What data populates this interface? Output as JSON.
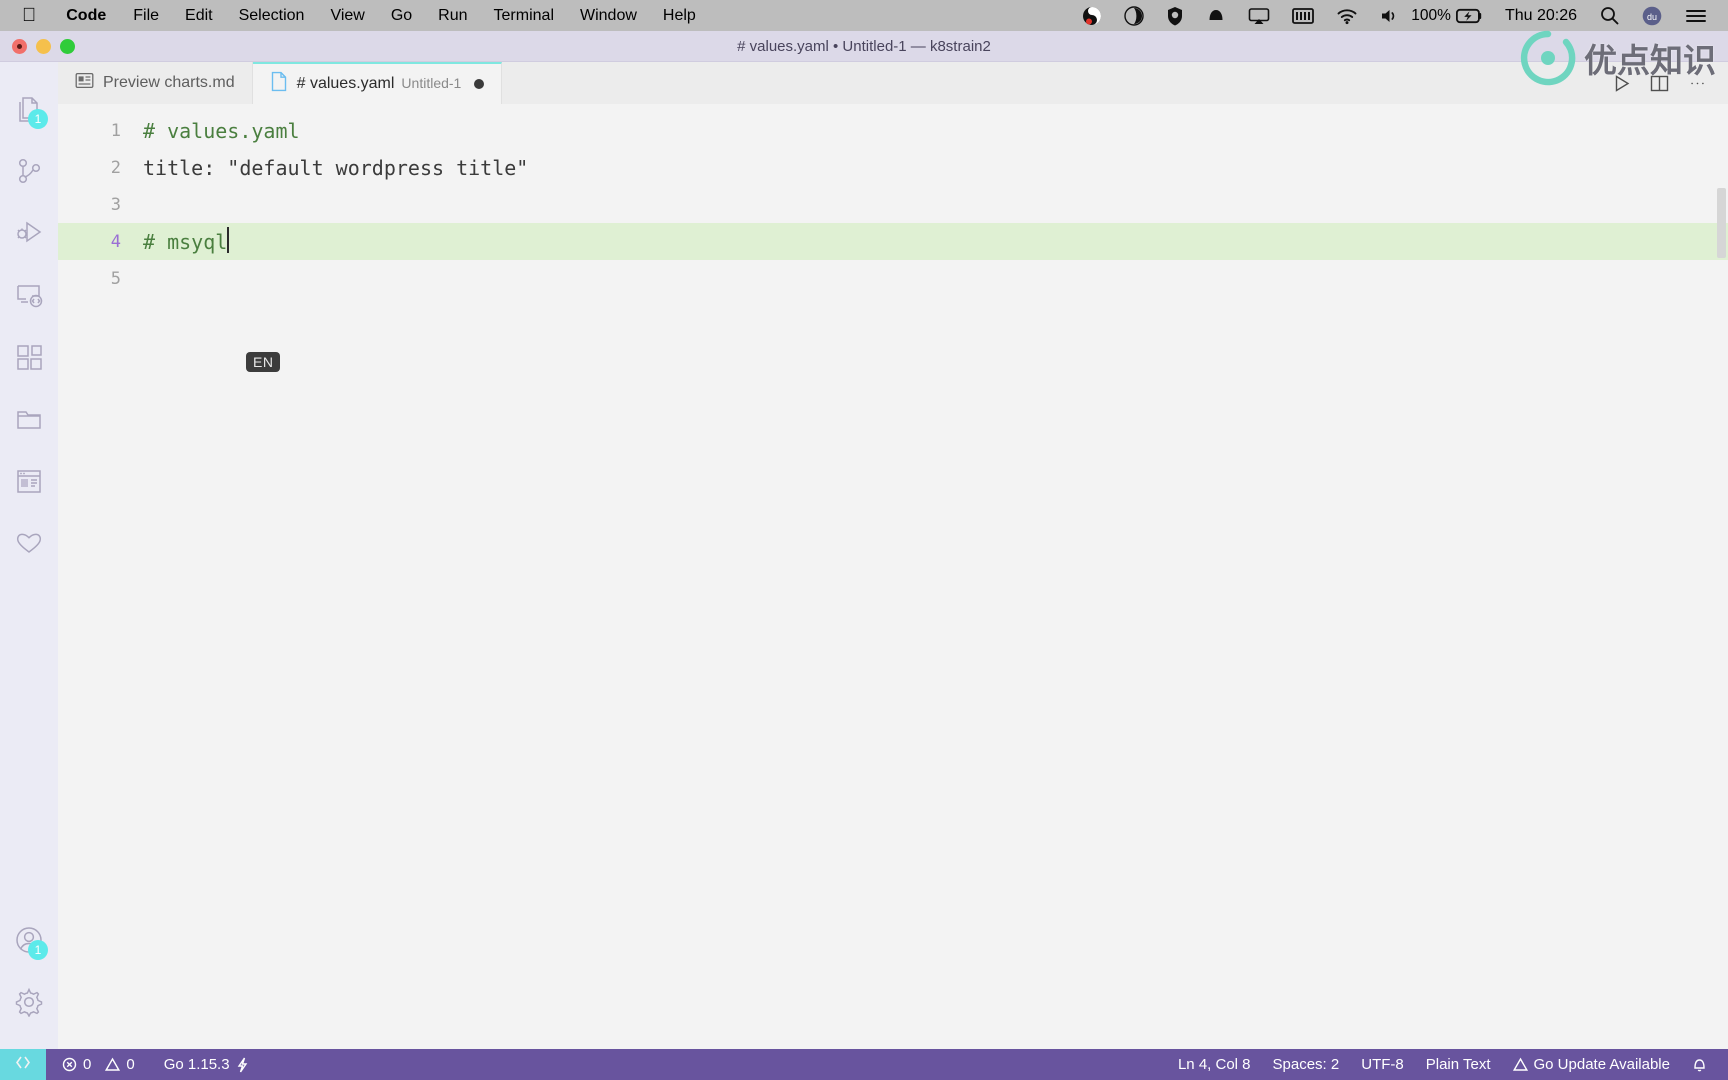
{
  "menubar": {
    "apple_icon": "apple-logo-icon",
    "items": [
      {
        "label": "Code",
        "bold": true
      },
      {
        "label": "File",
        "bold": false
      },
      {
        "label": "Edit",
        "bold": false
      },
      {
        "label": "Selection",
        "bold": false
      },
      {
        "label": "View",
        "bold": false
      },
      {
        "label": "Go",
        "bold": false
      },
      {
        "label": "Run",
        "bold": false
      },
      {
        "label": "Terminal",
        "bold": false
      },
      {
        "label": "Window",
        "bold": false
      },
      {
        "label": "Help",
        "bold": false
      }
    ],
    "status_icons": [
      "obs-recording-icon",
      "dropbox-icon",
      "shield-icon",
      "bell-notification-icon",
      "airplay-icon",
      "keyboard-icon",
      "wifi-icon",
      "volume-icon"
    ],
    "battery_percent": "100%",
    "battery_icon": "battery-charging-icon",
    "clock": "Thu 20:26",
    "search_icon": "search-icon",
    "siri_icon": "siri-icon",
    "control_center_icon": "control-center-icon"
  },
  "watermark": {
    "text": "优点知识",
    "logo_icon": "circle-dot-logo-icon",
    "accent": "#6fd5c0"
  },
  "titlebar": {
    "title": "# values.yaml • Untitled-1 — k8strain2",
    "traffic_lights": [
      "close-button",
      "minimize-button",
      "maximize-button"
    ]
  },
  "activitybar": {
    "items": [
      {
        "name": "explorer",
        "icon": "files-icon",
        "badge": "1"
      },
      {
        "name": "source-control",
        "icon": "source-control-icon",
        "badge": ""
      },
      {
        "name": "run-and-debug",
        "icon": "run-debug-icon",
        "badge": ""
      },
      {
        "name": "remote-explorer",
        "icon": "remote-explorer-icon",
        "badge": ""
      },
      {
        "name": "extensions",
        "icon": "extensions-icon",
        "badge": ""
      },
      {
        "name": "file-browser",
        "icon": "folder-icon",
        "badge": ""
      },
      {
        "name": "preview-browser",
        "icon": "browser-preview-icon",
        "badge": ""
      },
      {
        "name": "favorites",
        "icon": "heart-icon",
        "badge": ""
      }
    ],
    "bottom_items": [
      {
        "name": "accounts",
        "icon": "account-icon",
        "badge": "1"
      },
      {
        "name": "manage-settings",
        "icon": "gear-icon",
        "badge": ""
      }
    ]
  },
  "tabs": [
    {
      "label": "Preview charts.md",
      "sublabel": "",
      "icon": "preview-markdown-icon",
      "active": false,
      "dirty": false
    },
    {
      "label": "# values.yaml",
      "sublabel": "Untitled-1",
      "icon": "file-icon",
      "active": true,
      "dirty": true
    }
  ],
  "editor_actions": [
    {
      "name": "run-code",
      "icon": "play-icon"
    },
    {
      "name": "split-editor",
      "icon": "split-editor-icon"
    },
    {
      "name": "more-actions",
      "icon": "ellipsis-icon"
    }
  ],
  "editor": {
    "lines": [
      {
        "no": "1",
        "text": "# values.yaml",
        "type": "comment",
        "current": false
      },
      {
        "no": "2",
        "text": "title: \"default wordpress title\"",
        "type": "plain",
        "current": false
      },
      {
        "no": "3",
        "text": "",
        "type": "plain",
        "current": false
      },
      {
        "no": "4",
        "text": "# msyql",
        "type": "comment",
        "current": true
      },
      {
        "no": "5",
        "text": "",
        "type": "plain",
        "current": false
      }
    ],
    "ime_indicator": "EN",
    "cursor_line": 4
  },
  "statusbar": {
    "remote_icon": "remote-window-icon",
    "errors_icon": "error-circle-icon",
    "errors": "0",
    "warnings_icon": "warning-triangle-icon",
    "warnings": "0",
    "go_version": "Go 1.15.3",
    "go_icon": "lightning-icon",
    "cursor_position": "Ln 4, Col 8",
    "indentation": "Spaces: 2",
    "encoding": "UTF-8",
    "language_mode": "Plain Text",
    "update_warning_icon": "warning-triangle-icon",
    "update_notice": "Go Update Available",
    "bell_icon": "bell-icon",
    "background": "#68549e",
    "remote_background": "#68d9e0"
  }
}
